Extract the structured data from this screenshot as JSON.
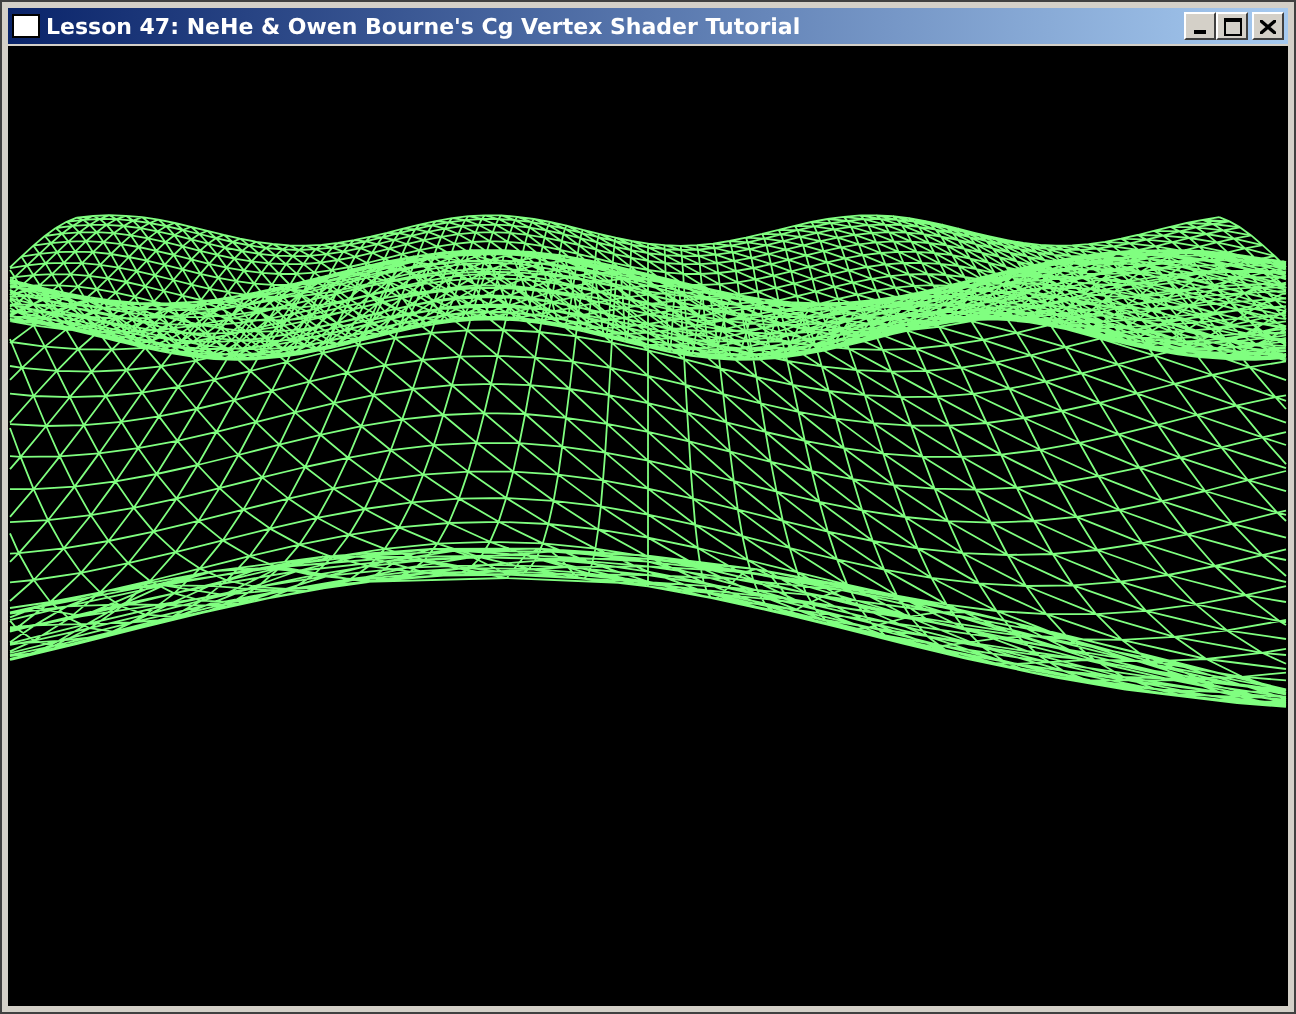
{
  "window": {
    "title": "Lesson 47: NeHe & Owen Bourne's Cg Vertex Shader Tutorial"
  }
}
